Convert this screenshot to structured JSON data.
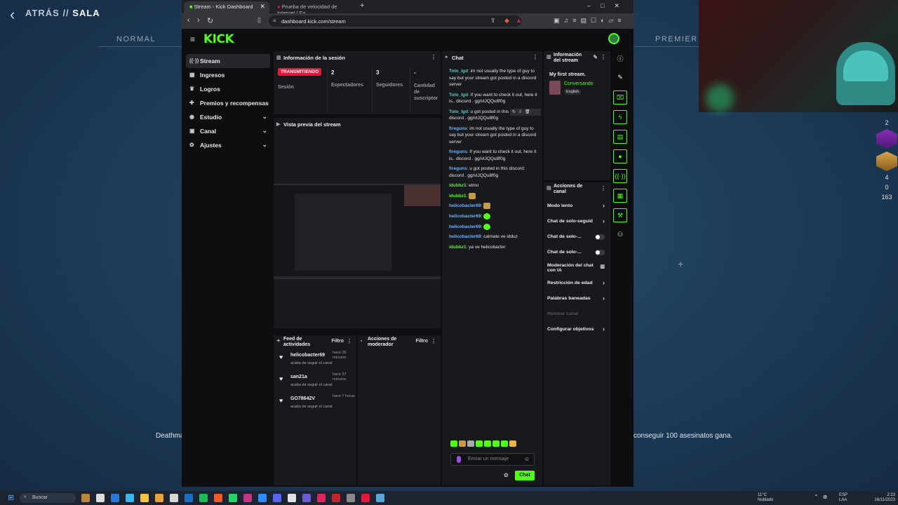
{
  "game": {
    "back_label": "ATRÁS",
    "separator": "//",
    "section": "SALA",
    "mode_left": "NORMAL",
    "mode_right": "PREMIER",
    "rule_left": "Deathmat",
    "rule_right": "conseguir 100 asesinatos gana.",
    "side_numbers": [
      "2",
      "4",
      "0",
      "163"
    ]
  },
  "browser": {
    "tab_active": "Stream - Kick Dashboard",
    "tab_inactive": "Prueba de velocidad de Internet | Fa",
    "url": "dashboard.kick.com/stream"
  },
  "kick": {
    "logo": "KICK",
    "nav": [
      {
        "label": "Stream",
        "icon": "stream-icon"
      },
      {
        "label": "Ingresos",
        "icon": "income-icon"
      },
      {
        "label": "Logros",
        "icon": "trophy-icon"
      },
      {
        "label": "Premios y recompensas",
        "icon": "gift-icon"
      },
      {
        "label": "Estudio",
        "icon": "studio-icon"
      },
      {
        "label": "Canal",
        "icon": "channel-icon"
      },
      {
        "label": "Ajustes",
        "icon": "settings-icon"
      }
    ],
    "session": {
      "title": "Información de la sesión",
      "live_badge": "TRANSMITIENDO",
      "live_label": "Sesión",
      "viewers_value": "2",
      "viewers_label": "Espectadores",
      "followers_value": "3",
      "followers_label": "Seguidores",
      "subs_value": "-",
      "subs_label_1": "Cantidad de",
      "subs_label_2": "suscriptor"
    },
    "preview_title": "Vista previa del stream",
    "feed": {
      "title_1": "Feed de",
      "title_2": "actividades",
      "filter": "Filtro",
      "items": [
        {
          "user": "helicobacter69",
          "time": "hace 36 minutos",
          "action": "acaba de seguir el canal"
        },
        {
          "user": "san21a",
          "time": "hace 37 minutos",
          "action": "acaba de seguir el canal"
        },
        {
          "user": "GO78642V",
          "time": "hace 7 horas",
          "action": "acaba de seguir el canal"
        }
      ]
    },
    "mod": {
      "title_1": "Acciones de",
      "title_2": "moderador",
      "filter": "Filtro"
    },
    "chat": {
      "title": "Chat",
      "messages": [
        {
          "user": "Toto_lgd",
          "color": "teal",
          "text": ": im not usually the type of guy to say but your stream got posted in a discord server"
        },
        {
          "user": "Toto_lgd",
          "color": "teal",
          "text": ": If you want to check it out, here it is.. discord . gg/vtJQQu8f0g"
        },
        {
          "user": "Toto_lgd",
          "color": "teal",
          "text": ": u got posted in this discord : discord . gg/vtJQQu8f0g"
        },
        {
          "user": "fireguns",
          "color": "blue",
          "text": ": im not usually the type of guy to say but your stream got posted in a discord server"
        },
        {
          "user": "fireguns",
          "color": "blue",
          "text": ": If you want to check it out, here it is.. discord . gg/vtJQQu8f0g"
        },
        {
          "user": "fireguns",
          "color": "blue",
          "text": ": u got posted in this discord: discord . gg/vtJQQu8f0g"
        },
        {
          "user": "idubbz1",
          "color": "green",
          "text": ": elmo"
        },
        {
          "user": "idubbz1",
          "color": "green",
          "text": ": ",
          "emote": "gold"
        },
        {
          "user": "helicobacter69",
          "color": "blue",
          "text": ": ",
          "emote": "gold"
        },
        {
          "user": "helicobacter69",
          "color": "blue",
          "text": ": ",
          "emote": "green"
        },
        {
          "user": "helicobacter69",
          "color": "blue",
          "text": ": ",
          "emote": "green"
        },
        {
          "user": "helicobacter69",
          "color": "blue",
          "text": ": calmate ve idduz"
        },
        {
          "user": "idubbz1",
          "color": "green",
          "text": ": ya ve helicobacter"
        }
      ],
      "input_placeholder": "Enviar un mensaje",
      "send_label": "Chat"
    },
    "stream_info": {
      "title_1": "Información",
      "title_2": "del stream",
      "stream_title": "My first stream.",
      "category": "Conversando",
      "language": "English"
    },
    "channel_actions": {
      "title_1": "Acciones de",
      "title_2": "canal",
      "items": [
        {
          "label": "Modo lento",
          "kind": "chevron"
        },
        {
          "label": "Chat de solo-seguid",
          "kind": "chevron"
        },
        {
          "label": "Chat de solo-...",
          "kind": "toggle"
        },
        {
          "label": "Chat de solo-...",
          "kind": "toggle"
        },
        {
          "label": "Moderación del chat con IA",
          "kind": "chart"
        },
        {
          "label": "Restricción de edad",
          "kind": "chevron"
        },
        {
          "label": "Palabras baneadas",
          "kind": "chevron"
        },
        {
          "label": "Hostear canal",
          "kind": "dim"
        },
        {
          "label": "Configurar objetivos",
          "kind": "chevron"
        }
      ]
    }
  },
  "taskbar": {
    "search": "Buscar",
    "weather_temp": "11°C",
    "weather_desc": "Nublado",
    "lang_1": "ESP",
    "lang_2": "LAA",
    "time": "2:23",
    "date": "16/11/2023"
  }
}
